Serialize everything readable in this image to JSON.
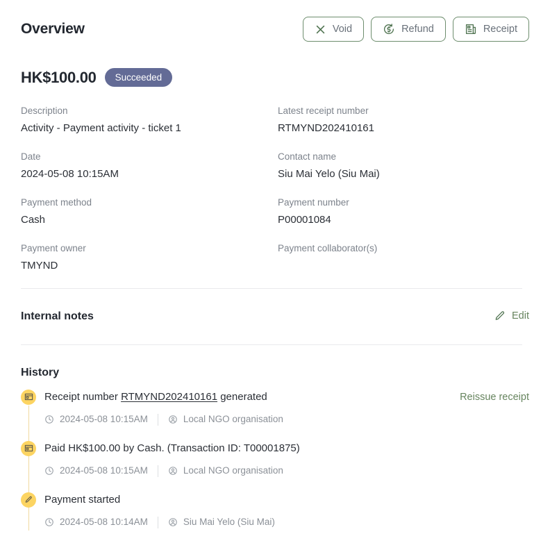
{
  "header": {
    "title": "Overview",
    "actions": [
      {
        "label": "Void",
        "icon": "close-x-icon"
      },
      {
        "label": "Refund",
        "icon": "refund-dollar-circle-icon"
      },
      {
        "label": "Receipt",
        "icon": "receipt-document-icon"
      }
    ]
  },
  "summary": {
    "amount": "HK$100.00",
    "status": "Succeeded"
  },
  "details": {
    "left": [
      {
        "label": "Description",
        "value": "Activity - Payment activity - ticket 1"
      },
      {
        "label": "Date",
        "value": "2024-05-08 10:15AM"
      },
      {
        "label": "Payment method",
        "value": "Cash"
      },
      {
        "label": "Payment owner",
        "value": "TMYND"
      }
    ],
    "right": [
      {
        "label": "Latest receipt number",
        "value": "RTMYND202410161"
      },
      {
        "label": "Contact name",
        "value": "Siu Mai Yelo (Siu Mai)"
      },
      {
        "label": "Payment number",
        "value": "P00001084"
      },
      {
        "label": "Payment collaborator(s)",
        "value": ""
      }
    ]
  },
  "internal_notes": {
    "title": "Internal notes",
    "edit_label": "Edit",
    "edit_icon": "pencil-icon"
  },
  "history": {
    "title": "History",
    "events": [
      {
        "icon": "receipt-card-icon",
        "text_before": "Receipt number ",
        "link": "RTMYND202410161",
        "text_after": " generated",
        "action": "Reissue receipt",
        "timestamp": "2024-05-08 10:15AM",
        "actor": "Local NGO organisation"
      },
      {
        "icon": "receipt-card-icon",
        "text_before": "Paid HK$100.00 by Cash. (Transaction ID: T00001875)",
        "link": "",
        "text_after": "",
        "action": "",
        "timestamp": "2024-05-08 10:15AM",
        "actor": "Local NGO organisation"
      },
      {
        "icon": "pencil-icon",
        "text_before": "Payment started",
        "link": "",
        "text_after": "",
        "action": "",
        "timestamp": "2024-05-08 10:14AM",
        "actor": "Siu Mai Yelo (Siu Mai)"
      }
    ]
  },
  "colors": {
    "accent_green": "#5a7a5a",
    "status_badge": "#636b96",
    "timeline_bullet": "#fcd462",
    "link_green": "#67855f"
  }
}
